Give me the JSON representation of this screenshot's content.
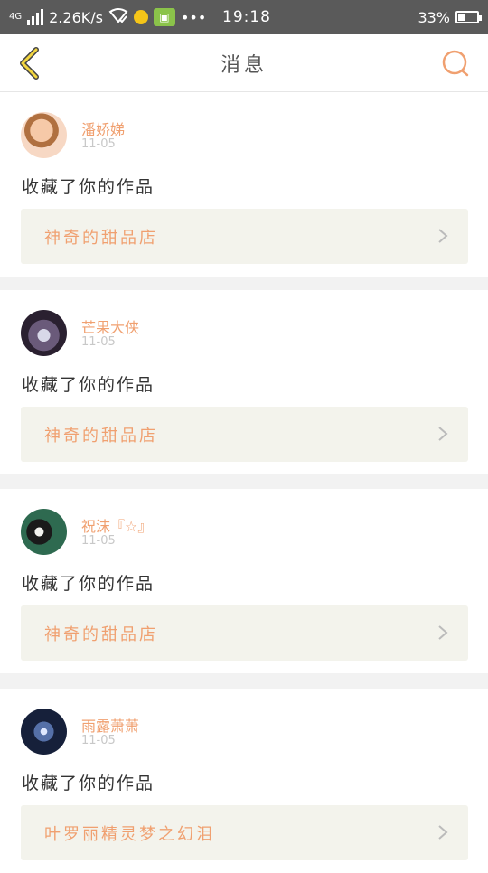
{
  "statusbar": {
    "network": "4G",
    "speed": "2.26K/s",
    "time": "19:18",
    "battery": "33%",
    "battery_level": 0.33
  },
  "nav": {
    "title": "消息",
    "back_icon": "chevron-left-icon",
    "search_icon": "search-icon",
    "accent": "#f0a070"
  },
  "messages": [
    {
      "user": "潘娇娣",
      "date": "11-05",
      "action": "收藏了你的作品",
      "work": "神奇的甜品店"
    },
    {
      "user": "芒果大侠",
      "date": "11-05",
      "action": "收藏了你的作品",
      "work": "神奇的甜品店"
    },
    {
      "user": "祝沫『☆』",
      "date": "11-05",
      "action": "收藏了你的作品",
      "work": "神奇的甜品店"
    },
    {
      "user": "雨露萧萧",
      "date": "11-05",
      "action": "收藏了你的作品",
      "work": "叶罗丽精灵梦之幻泪"
    }
  ]
}
